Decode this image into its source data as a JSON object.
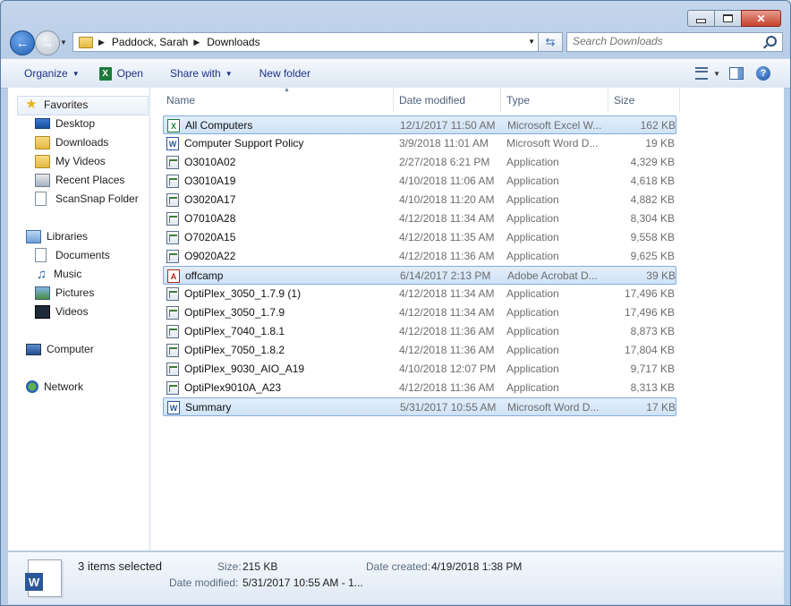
{
  "window": {
    "breadcrumb": [
      "Paddock, Sarah",
      "Downloads"
    ],
    "search_placeholder": "Search Downloads",
    "controls": {
      "close_glyph": "✕"
    }
  },
  "toolbar": {
    "organize": "Organize",
    "open": "Open",
    "share_with": "Share with",
    "new_folder": "New folder"
  },
  "nav": {
    "favorites": "Favorites",
    "favorite_items": [
      "Desktop",
      "Downloads",
      "My Videos",
      "Recent Places",
      "ScanSnap Folder"
    ],
    "libraries": "Libraries",
    "library_items": [
      "Documents",
      "Music",
      "Pictures",
      "Videos"
    ],
    "computer": "Computer",
    "network": "Network"
  },
  "columns": [
    "Name",
    "Date modified",
    "Type",
    "Size"
  ],
  "files": [
    {
      "name": "All Computers",
      "date": "12/1/2017 11:50 AM",
      "type": "Microsoft Excel W...",
      "size": "162 KB",
      "icon": "excel-icon",
      "selected": true
    },
    {
      "name": "Computer Support Policy",
      "date": "3/9/2018 11:01 AM",
      "type": "Microsoft Word D...",
      "size": "19 KB",
      "icon": "word-icon",
      "selected": false
    },
    {
      "name": "O3010A02",
      "date": "2/27/2018 6:21 PM",
      "type": "Application",
      "size": "4,329 KB",
      "icon": "application-icon",
      "selected": false
    },
    {
      "name": "O3010A19",
      "date": "4/10/2018 11:06 AM",
      "type": "Application",
      "size": "4,618 KB",
      "icon": "application-icon",
      "selected": false
    },
    {
      "name": "O3020A17",
      "date": "4/10/2018 11:20 AM",
      "type": "Application",
      "size": "4,882 KB",
      "icon": "application-icon",
      "selected": false
    },
    {
      "name": "O7010A28",
      "date": "4/12/2018 11:34 AM",
      "type": "Application",
      "size": "8,304 KB",
      "icon": "application-icon",
      "selected": false
    },
    {
      "name": "O7020A15",
      "date": "4/12/2018 11:35 AM",
      "type": "Application",
      "size": "9,558 KB",
      "icon": "application-icon",
      "selected": false
    },
    {
      "name": "O9020A22",
      "date": "4/12/2018 11:36 AM",
      "type": "Application",
      "size": "9,625 KB",
      "icon": "application-icon",
      "selected": false
    },
    {
      "name": "offcamp",
      "date": "6/14/2017 2:13 PM",
      "type": "Adobe Acrobat D...",
      "size": "39 KB",
      "icon": "pdf-icon",
      "selected": true
    },
    {
      "name": "OptiPlex_3050_1.7.9 (1)",
      "date": "4/12/2018 11:34 AM",
      "type": "Application",
      "size": "17,496 KB",
      "icon": "application-icon",
      "selected": false
    },
    {
      "name": "OptiPlex_3050_1.7.9",
      "date": "4/12/2018 11:34 AM",
      "type": "Application",
      "size": "17,496 KB",
      "icon": "application-icon",
      "selected": false
    },
    {
      "name": "OptiPlex_7040_1.8.1",
      "date": "4/12/2018 11:36 AM",
      "type": "Application",
      "size": "8,873 KB",
      "icon": "application-icon",
      "selected": false
    },
    {
      "name": "OptiPlex_7050_1.8.2",
      "date": "4/12/2018 11:36 AM",
      "type": "Application",
      "size": "17,804 KB",
      "icon": "application-icon",
      "selected": false
    },
    {
      "name": "OptiPlex_9030_AIO_A19",
      "date": "4/10/2018 12:07 PM",
      "type": "Application",
      "size": "9,717 KB",
      "icon": "application-icon",
      "selected": false
    },
    {
      "name": "OptiPlex9010A_A23",
      "date": "4/12/2018 11:36 AM",
      "type": "Application",
      "size": "8,313 KB",
      "icon": "application-icon",
      "selected": false
    },
    {
      "name": "Summary",
      "date": "5/31/2017 10:55 AM",
      "type": "Microsoft Word D...",
      "size": "17 KB",
      "icon": "word-icon",
      "selected": true
    }
  ],
  "details": {
    "selection": "3 items selected",
    "size_label": "Size:",
    "size_value": "215 KB",
    "created_label": "Date created:",
    "created_value": "4/19/2018 1:38 PM",
    "modified_label": "Date modified:",
    "modified_value": "5/31/2017 10:55 AM - 1..."
  },
  "colors": {
    "selection_fill": "#cfe2f7",
    "selection_border": "#84acdd",
    "toolbar_text": "#1e3287"
  }
}
